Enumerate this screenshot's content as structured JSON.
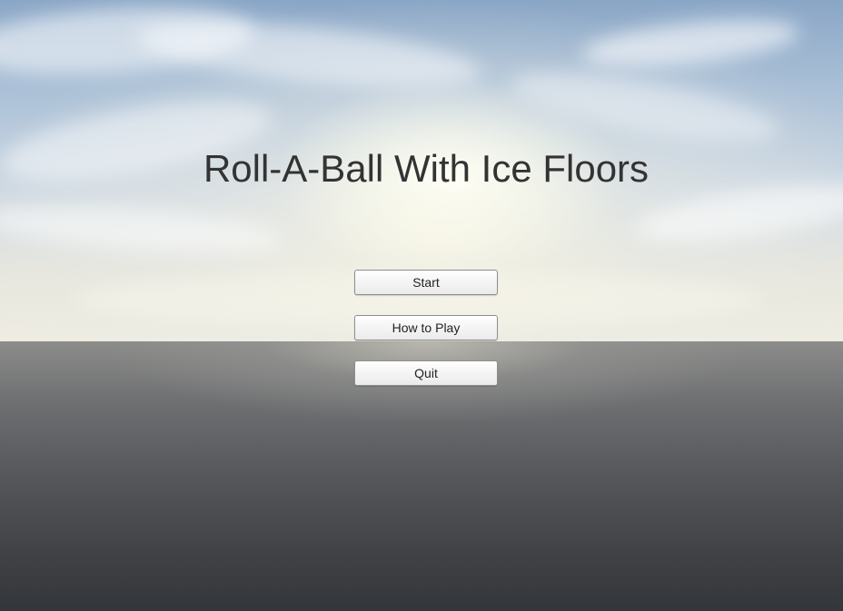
{
  "game": {
    "title": "Roll-A-Ball With Ice Floors"
  },
  "menu": {
    "buttons": [
      {
        "label": "Start"
      },
      {
        "label": "How to Play"
      },
      {
        "label": "Quit"
      }
    ]
  },
  "scene": {
    "background": "skybox-with-clouds-and-horizon"
  }
}
